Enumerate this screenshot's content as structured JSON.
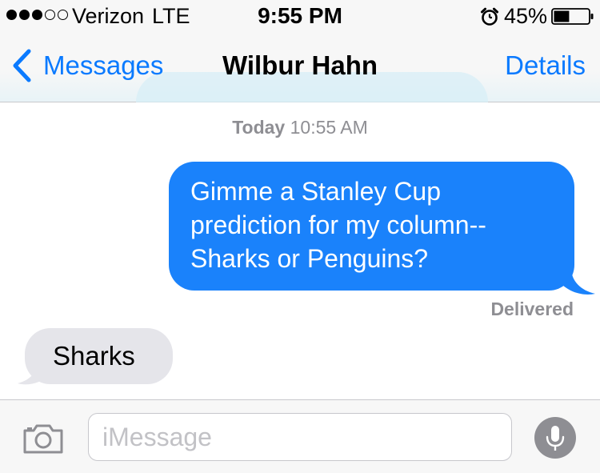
{
  "status_bar": {
    "signal_bars_filled": 3,
    "signal_bars_total": 5,
    "carrier": "Verizon",
    "network": "LTE",
    "time": "9:55 PM",
    "alarm_icon": "alarm-clock-icon",
    "battery_percent": "45%",
    "battery_level": 0.45
  },
  "nav": {
    "back_label": "Messages",
    "back_icon": "chevron-left-icon",
    "contact_name": "Wilbur Hahn",
    "details_label": "Details",
    "accent_color": "#0a7aff"
  },
  "conversation": {
    "timestamp_day": "Today",
    "timestamp_time": "10:55 AM",
    "messages": [
      {
        "direction": "outgoing",
        "lines": [
          "Gimme a Stanley Cup",
          "prediction for my column--",
          "Sharks or Penguins?"
        ],
        "color": "#1a82fb",
        "status": "Delivered"
      },
      {
        "direction": "incoming",
        "lines": [
          "Sharks"
        ],
        "color": "#e5e5ea"
      }
    ]
  },
  "input_bar": {
    "camera_icon": "camera-icon",
    "placeholder": "iMessage",
    "value": "",
    "mic_icon": "microphone-icon"
  }
}
